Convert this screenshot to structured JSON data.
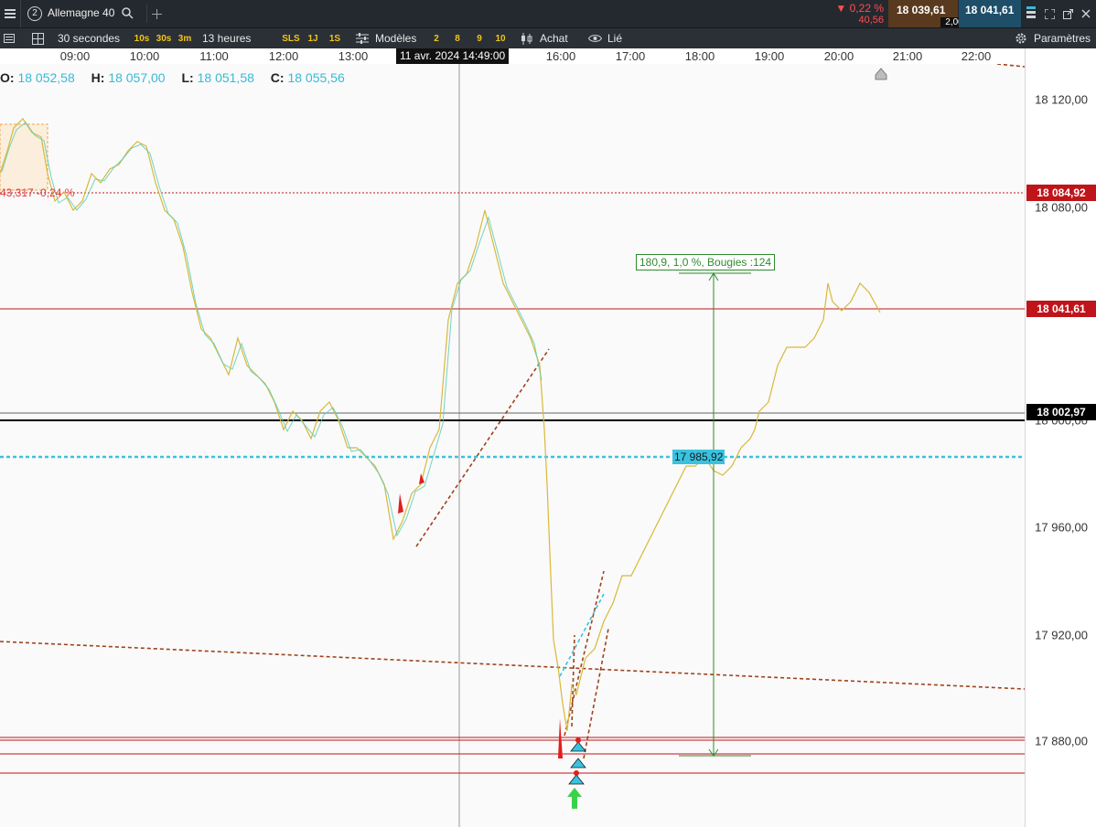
{
  "topbar": {
    "instrument_number": "2",
    "instrument_name": "Allemagne 40",
    "change_pct": "▼ 0,22 %",
    "change_pts": "40,56",
    "bid": "18 039,61",
    "ask": "18 041,61",
    "spread": "2,00"
  },
  "toolbar": {
    "interval": "30 secondes",
    "quick_intervals": [
      "10s",
      "30s",
      "3m"
    ],
    "period": "13 heures",
    "quick_periods": [
      "SLS",
      "1J",
      "1S"
    ],
    "models_label": "Modèles",
    "model_slots": [
      "2",
      "8",
      "9",
      "10"
    ],
    "buy_label": "Achat",
    "linked_label": "Lié",
    "settings_label": "Paramètres"
  },
  "time_axis": {
    "labels": [
      "09:00",
      "10:00",
      "11:00",
      "12:00",
      "13:00",
      "16:00",
      "17:00",
      "18:00",
      "19:00",
      "20:00",
      "21:00",
      "22:00"
    ],
    "cursor_label": "11 avr. 2024 14:49:00"
  },
  "ohlc": {
    "o_label": "O:",
    "o": "18 052,58",
    "h_label": "H:",
    "h": "18 057,00",
    "l_label": "L:",
    "l": "18 051,58",
    "c_label": "C:",
    "c": "18 055,56"
  },
  "price_axis": {
    "labels": [
      "18 120,00",
      "18 080,00",
      "17 960,00",
      "17 920,00",
      "17 880,00"
    ],
    "partial_label": "18 000,00",
    "marker_high": "18 084,92",
    "marker_last": "18 041,61",
    "marker_level": "18 002,97"
  },
  "annotations": {
    "prev_close_text": "43,317 -0,24 %",
    "measure_text": "180,9, 1,0 %, Bougies :124",
    "dotted_level_text": "17 985,92"
  },
  "colors": {
    "accent_red": "#c0141b",
    "accent_cyan": "#39b9d6",
    "measure_green": "#2e8b2e",
    "trend_brown": "#a0421e",
    "ask_bg": "#1e4e68",
    "bid_bg": "#5a3a1e"
  },
  "icons": {
    "menu": "hamburger-icon",
    "search": "search-icon",
    "add": "plus-icon",
    "panels": "panel-layout-icon",
    "models": "sliders-icon",
    "buy": "candles-icon",
    "linked": "eye-icon",
    "settings": "gear-icon"
  }
}
